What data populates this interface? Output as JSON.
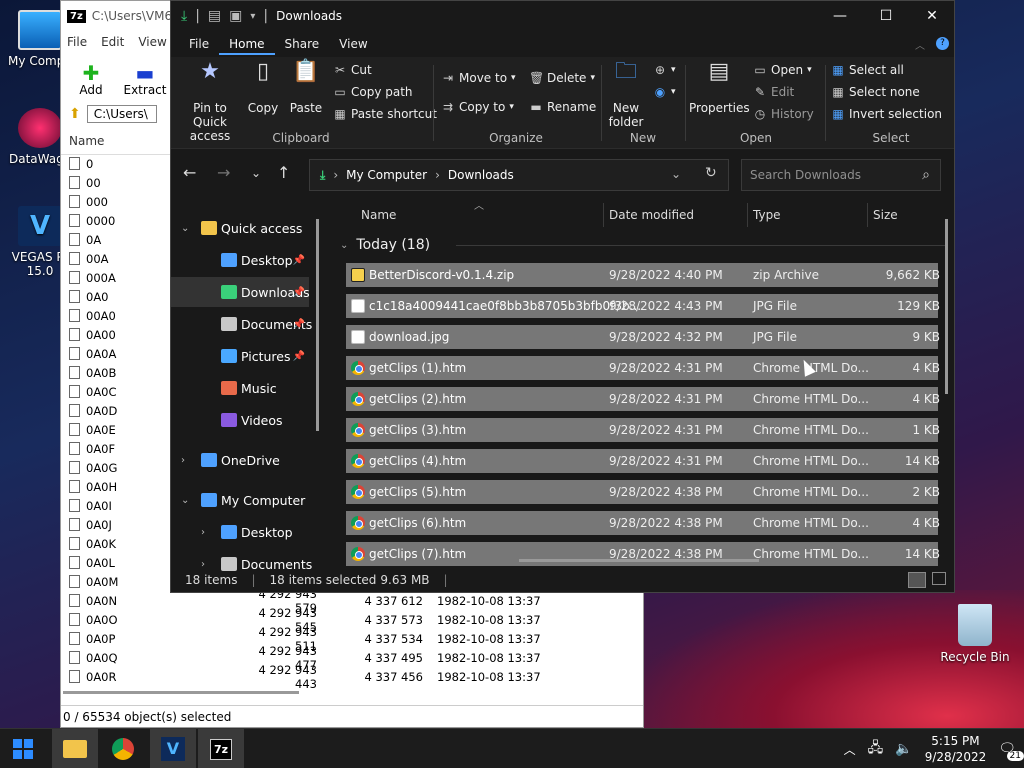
{
  "desktop": {
    "icons": [
      {
        "label": "My Compu"
      },
      {
        "label": "DataWago"
      },
      {
        "label": "VEGAS Pr 15.0"
      },
      {
        "label": "Recycle Bin"
      }
    ]
  },
  "sevenzip": {
    "title": "C:\\Users\\VM6\\",
    "menu": [
      "File",
      "Edit",
      "View"
    ],
    "toolbar": [
      "Add",
      "Extract",
      "Te"
    ],
    "address": "C:\\Users\\",
    "name_header": "Name",
    "rows": [
      {
        "name": "0",
        "size": "",
        "packed": "",
        "date": ""
      },
      {
        "name": "00",
        "size": "",
        "packed": "",
        "date": ""
      },
      {
        "name": "000",
        "size": "",
        "packed": "",
        "date": ""
      },
      {
        "name": "0000",
        "size": "",
        "packed": "",
        "date": ""
      },
      {
        "name": "0A",
        "size": "",
        "packed": "",
        "date": ""
      },
      {
        "name": "00A",
        "size": "",
        "packed": "",
        "date": ""
      },
      {
        "name": "000A",
        "size": "",
        "packed": "",
        "date": ""
      },
      {
        "name": "0A0",
        "size": "",
        "packed": "",
        "date": ""
      },
      {
        "name": "00A0",
        "size": "",
        "packed": "",
        "date": ""
      },
      {
        "name": "0A00",
        "size": "",
        "packed": "",
        "date": ""
      },
      {
        "name": "0A0A",
        "size": "",
        "packed": "",
        "date": ""
      },
      {
        "name": "0A0B",
        "size": "",
        "packed": "",
        "date": ""
      },
      {
        "name": "0A0C",
        "size": "",
        "packed": "",
        "date": ""
      },
      {
        "name": "0A0D",
        "size": "",
        "packed": "",
        "date": ""
      },
      {
        "name": "0A0E",
        "size": "",
        "packed": "",
        "date": ""
      },
      {
        "name": "0A0F",
        "size": "",
        "packed": "",
        "date": ""
      },
      {
        "name": "0A0G",
        "size": "",
        "packed": "",
        "date": ""
      },
      {
        "name": "0A0H",
        "size": "",
        "packed": "",
        "date": ""
      },
      {
        "name": "0A0I",
        "size": "",
        "packed": "",
        "date": ""
      },
      {
        "name": "0A0J",
        "size": "",
        "packed": "",
        "date": ""
      },
      {
        "name": "0A0K",
        "size": "",
        "packed": "",
        "date": ""
      },
      {
        "name": "0A0L",
        "size": "",
        "packed": "",
        "date": ""
      },
      {
        "name": "0A0M",
        "size": "",
        "packed": "",
        "date": ""
      },
      {
        "name": "0A0N",
        "size": "4 292 943 579",
        "packed": "4 337 612",
        "date": "1982-10-08 13:37"
      },
      {
        "name": "0A0O",
        "size": "4 292 943 545",
        "packed": "4 337 573",
        "date": "1982-10-08 13:37"
      },
      {
        "name": "0A0P",
        "size": "4 292 943 511",
        "packed": "4 337 534",
        "date": "1982-10-08 13:37"
      },
      {
        "name": "0A0Q",
        "size": "4 292 943 477",
        "packed": "4 337 495",
        "date": "1982-10-08 13:37"
      },
      {
        "name": "0A0R",
        "size": "4 292 943 443",
        "packed": "4 337 456",
        "date": "1982-10-08 13:37"
      }
    ],
    "status": "0 / 65534 object(s) selected"
  },
  "explorer": {
    "title": "Downloads",
    "tabs": [
      "File",
      "Home",
      "Share",
      "View"
    ],
    "ribbon": {
      "pin_label": "Pin to Quick access",
      "copy": "Copy",
      "paste": "Paste",
      "cut": "Cut",
      "copy_path": "Copy path",
      "paste_shortcut": "Paste shortcut",
      "clipboard": "Clipboard",
      "move_to": "Move to",
      "copy_to": "Copy to",
      "delete": "Delete",
      "rename": "Rename",
      "organize": "Organize",
      "new_folder": "New folder",
      "new": "New",
      "properties": "Properties",
      "open": "Open",
      "edit": "Edit",
      "history": "History",
      "open_group": "Open",
      "select_all": "Select all",
      "select_none": "Select none",
      "invert_selection": "Invert selection",
      "select": "Select"
    },
    "path": [
      "My Computer",
      "Downloads"
    ],
    "search_placeholder": "Search Downloads",
    "nav": [
      {
        "label": "Quick access",
        "level": 0
      },
      {
        "label": "Desktop",
        "level": 1
      },
      {
        "label": "Downloads",
        "level": 1
      },
      {
        "label": "Documents",
        "level": 1
      },
      {
        "label": "Pictures",
        "level": 1
      },
      {
        "label": "Music",
        "level": 1
      },
      {
        "label": "Videos",
        "level": 1
      },
      {
        "label": "OneDrive",
        "level": 0
      },
      {
        "label": "My Computer",
        "level": 0
      },
      {
        "label": "Desktop",
        "level": 1
      },
      {
        "label": "Documents",
        "level": 1
      }
    ],
    "columns": [
      "Name",
      "Date modified",
      "Type",
      "Size"
    ],
    "group": "Today (18)",
    "files": [
      {
        "name": "BetterDiscord-v0.1.4.zip",
        "date": "9/28/2022 4:40 PM",
        "type": "zip Archive",
        "size": "9,662 KB",
        "icon": "zip"
      },
      {
        "name": "c1c18a4009441cae0f8bb3b8705b3bfb0f3b...",
        "date": "9/28/2022 4:43 PM",
        "type": "JPG File",
        "size": "129 KB",
        "icon": "jpg"
      },
      {
        "name": "download.jpg",
        "date": "9/28/2022 4:32 PM",
        "type": "JPG File",
        "size": "9 KB",
        "icon": "jpg"
      },
      {
        "name": "getClips (1).htm",
        "date": "9/28/2022 4:31 PM",
        "type": "Chrome HTML Do...",
        "size": "4 KB",
        "icon": "chrome"
      },
      {
        "name": "getClips (2).htm",
        "date": "9/28/2022 4:31 PM",
        "type": "Chrome HTML Do...",
        "size": "4 KB",
        "icon": "chrome"
      },
      {
        "name": "getClips (3).htm",
        "date": "9/28/2022 4:31 PM",
        "type": "Chrome HTML Do...",
        "size": "1 KB",
        "icon": "chrome"
      },
      {
        "name": "getClips (4).htm",
        "date": "9/28/2022 4:31 PM",
        "type": "Chrome HTML Do...",
        "size": "14 KB",
        "icon": "chrome"
      },
      {
        "name": "getClips (5).htm",
        "date": "9/28/2022 4:38 PM",
        "type": "Chrome HTML Do...",
        "size": "2 KB",
        "icon": "chrome"
      },
      {
        "name": "getClips (6).htm",
        "date": "9/28/2022 4:38 PM",
        "type": "Chrome HTML Do...",
        "size": "4 KB",
        "icon": "chrome"
      },
      {
        "name": "getClips (7).htm",
        "date": "9/28/2022 4:38 PM",
        "type": "Chrome HTML Do...",
        "size": "14 KB",
        "icon": "chrome"
      }
    ],
    "status": {
      "items": "18 items",
      "selected": "18 items selected",
      "size": "9.63 MB"
    }
  },
  "taskbar": {
    "time": "5:15 PM",
    "date": "9/28/2022",
    "notifications": "21"
  },
  "colors": {
    "accent": "#4ea1ff",
    "selected_row": "#777777",
    "explorer_bg": "#191919"
  }
}
